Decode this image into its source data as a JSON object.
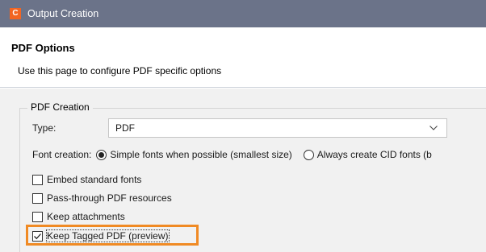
{
  "window": {
    "app_icon_letter": "C",
    "title": "Output Creation"
  },
  "header": {
    "title": "PDF Options",
    "description": "Use this page to configure PDF specific options"
  },
  "pdf_creation": {
    "group_label": "PDF Creation",
    "type_label": "Type:",
    "type_value": "PDF",
    "font_creation_label": "Font creation:",
    "font_options": [
      {
        "label": "Simple fonts when possible (smallest size)",
        "selected": true
      },
      {
        "label": "Always create CID fonts (b",
        "selected": false
      }
    ],
    "checkboxes": [
      {
        "label": "Embed standard fonts",
        "checked": false
      },
      {
        "label": "Pass-through PDF resources",
        "checked": false
      },
      {
        "label": "Keep attachments",
        "checked": false
      },
      {
        "label": "Keep Tagged PDF (preview)",
        "checked": true
      }
    ]
  },
  "colors": {
    "titlebar": "#6b7389",
    "app_icon": "#f26522",
    "highlight": "#f08a24"
  }
}
